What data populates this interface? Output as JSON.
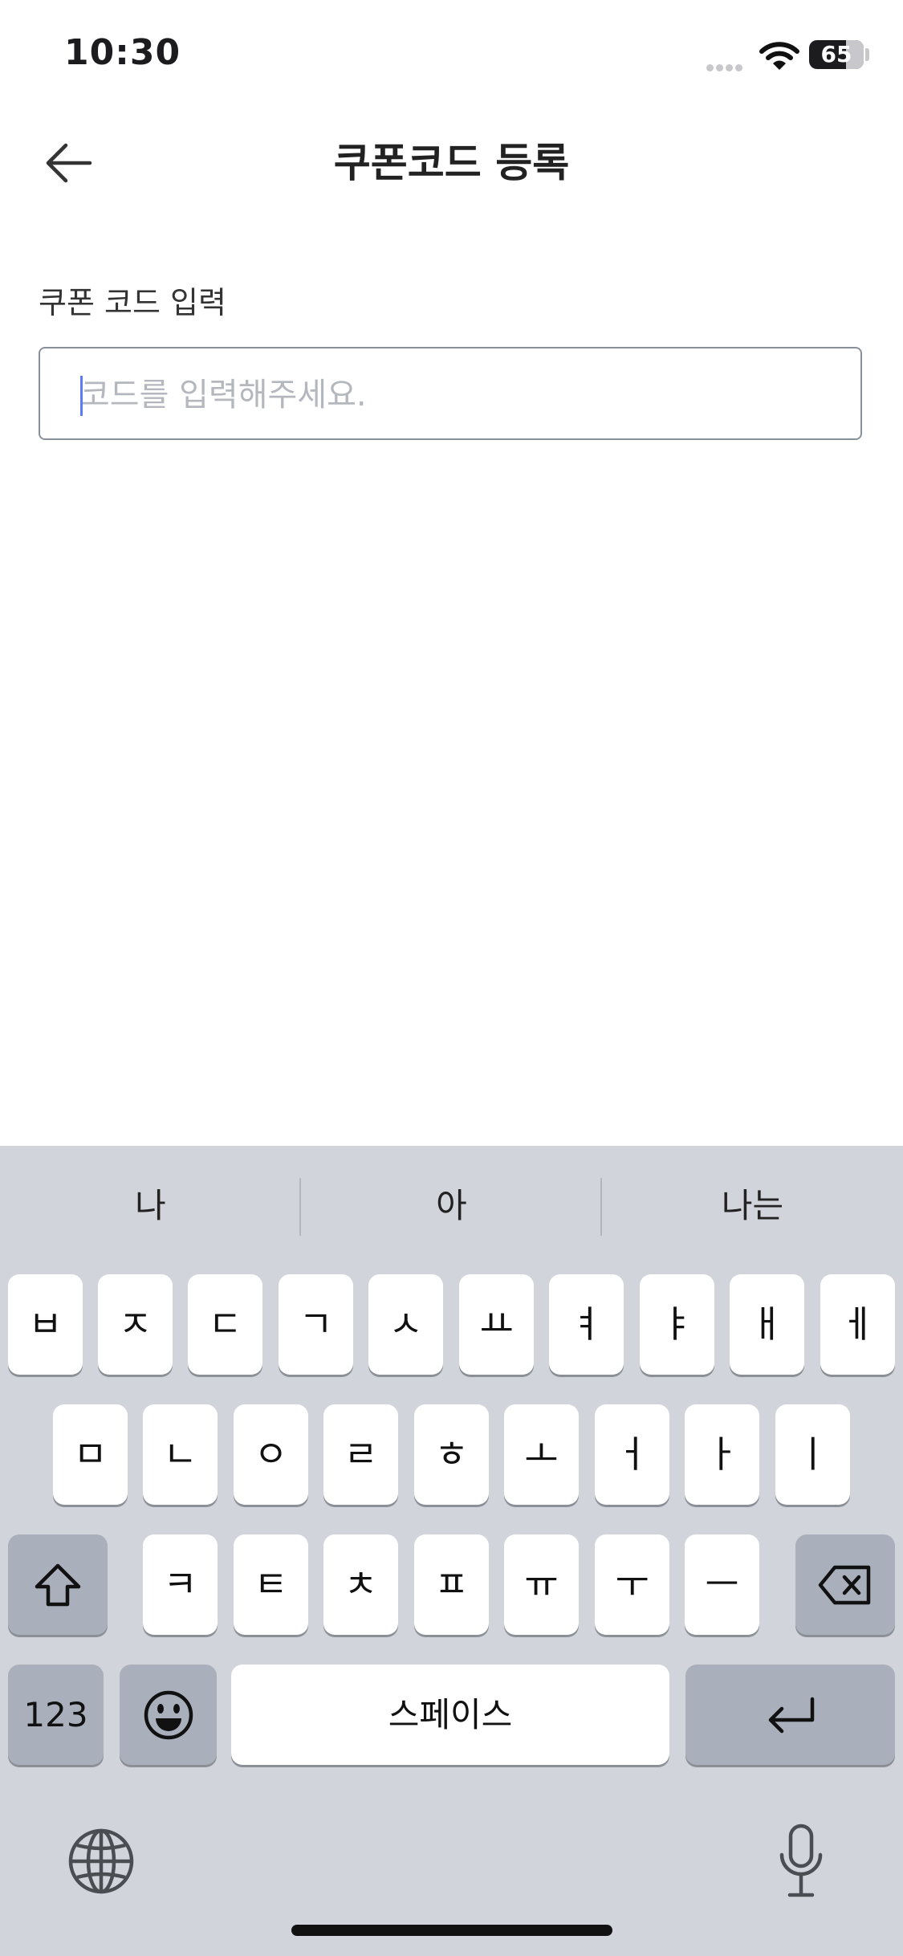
{
  "status_bar": {
    "time": "10:30",
    "battery": "65"
  },
  "header": {
    "title": "쿠폰코드 등록"
  },
  "form": {
    "label": "쿠폰 코드 입력",
    "placeholder": "코드를 입력해주세요.",
    "value": ""
  },
  "keyboard": {
    "suggestions": [
      "나",
      "아",
      "나는"
    ],
    "row1": [
      "ㅂ",
      "ㅈ",
      "ㄷ",
      "ㄱ",
      "ㅅ",
      "ㅛ",
      "ㅕ",
      "ㅑ",
      "ㅐ",
      "ㅔ"
    ],
    "row2": [
      "ㅁ",
      "ㄴ",
      "ㅇ",
      "ㄹ",
      "ㅎ",
      "ㅗ",
      "ㅓ",
      "ㅏ",
      "ㅣ"
    ],
    "row3": [
      "ㅋ",
      "ㅌ",
      "ㅊ",
      "ㅍ",
      "ㅠ",
      "ㅜ",
      "ㅡ"
    ],
    "numbers_key": "123",
    "space_key": "스페이스"
  }
}
